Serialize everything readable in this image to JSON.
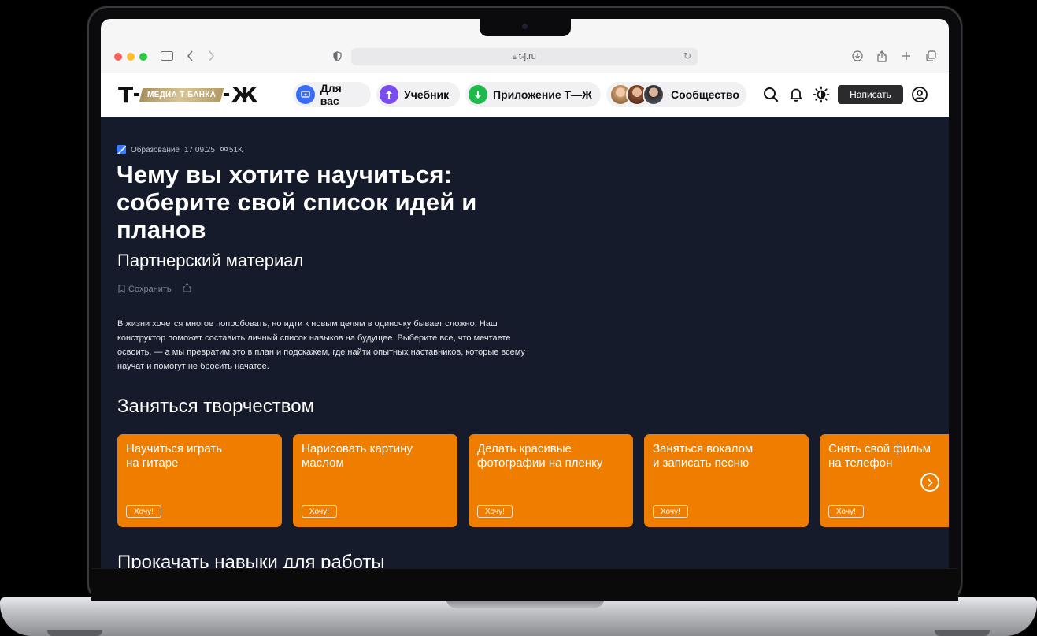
{
  "browser": {
    "url": "t-j.ru"
  },
  "header": {
    "logo": {
      "left": "Т",
      "ribbon": "МЕДИА Т-БАНКА",
      "right": "Ж"
    },
    "nav": [
      {
        "label": "Для вас",
        "icon": "for-you-icon",
        "color": "#3b6ef6"
      },
      {
        "label": "Учебник",
        "icon": "textbook-icon",
        "color": "#7a4df0"
      },
      {
        "label": "Приложение Т—Ж",
        "icon": "download-icon",
        "color": "#1fb94b"
      },
      {
        "label": "Сообщество",
        "icon": "community-avatars"
      }
    ],
    "write_label": "Написать"
  },
  "article": {
    "category": "Образование",
    "date": "17.09.25",
    "views": "51K",
    "title": "Чему вы хотите научиться: соберите свой список идей и планов",
    "subtitle": "Партнерский материал",
    "save_label": "Сохранить",
    "lead": "В жизни хочется многое попробовать, но идти к новым целям в одиночку бывает сложно. Наш конструктор поможет составить личный список навыков на будущее. Выберите все, что мечтаете освоить, — а мы превратим это в план и подскажем, где найти опытных наставников, которые всему научат и помогут не бросить начатое."
  },
  "sections": [
    {
      "title": "Заняться творчеством",
      "cards": [
        {
          "title": "Научиться играть\nна гитаре",
          "button": "Хочу!"
        },
        {
          "title": "Нарисовать картину\nмаслом",
          "button": "Хочу!"
        },
        {
          "title": "Делать красивые\nфотографии на пленку",
          "button": "Хочу!"
        },
        {
          "title": "Заняться вокалом\nи записать песню",
          "button": "Хочу!"
        },
        {
          "title": "Снять свой фильм\nна телефон",
          "button": "Хочу!"
        }
      ]
    },
    {
      "title": "Прокачать навыки для работы"
    }
  ],
  "colors": {
    "page_bg": "#151b2a",
    "card_bg": "#ee7d00",
    "header_bg": "#ffffff"
  }
}
